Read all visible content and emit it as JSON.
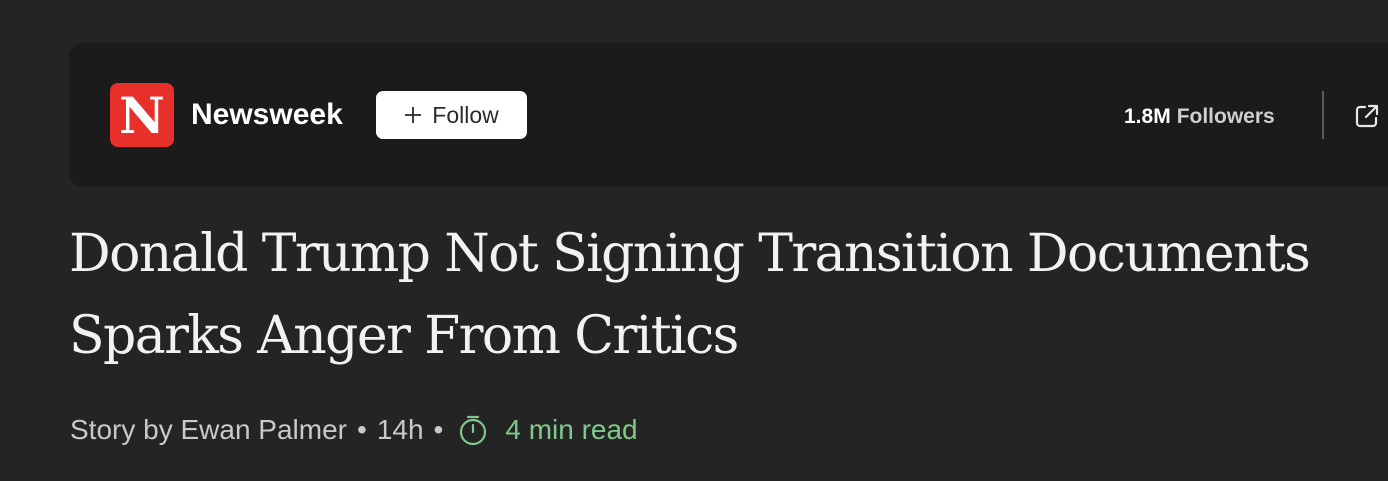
{
  "publisher": {
    "logo_letter": "N",
    "name": "Newsweek",
    "follow_label": "Follow",
    "followers_count": "1.8M",
    "followers_label": "Followers"
  },
  "article": {
    "headline": "Donald Trump Not Signing Transition Documents Sparks Anger From Critics",
    "byline": "Story by Ewan Palmer",
    "separator": "•",
    "time_ago": "14h",
    "read_time": "4 min read"
  },
  "icons": {
    "follow": "plus-icon",
    "external": "open-external-icon",
    "read_time": "timer-icon"
  },
  "colors": {
    "background": "#242424",
    "card": "#1b1b1b",
    "logo": "#e8302a",
    "read_time": "#7fc98a"
  }
}
